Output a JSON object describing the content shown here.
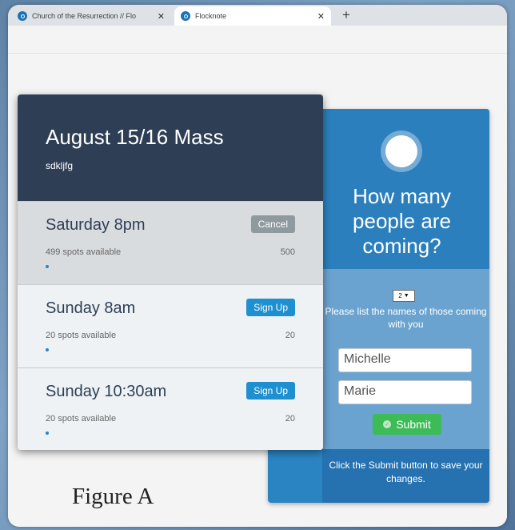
{
  "browser": {
    "tabs": [
      {
        "title": "Church of the Resurrection // Flo",
        "close": "✕"
      },
      {
        "title": "Flocknote",
        "close": "✕"
      }
    ],
    "new_tab": "+"
  },
  "event": {
    "title": "August 15/16 Mass",
    "subtitle": "sdkljfg",
    "slots": [
      {
        "name": "Saturday 8pm",
        "available": "499 spots available",
        "count": "500",
        "button": "Cancel"
      },
      {
        "name": "Sunday 8am",
        "available": "20 spots available",
        "count": "20",
        "button": "Sign Up"
      },
      {
        "name": "Sunday 10:30am",
        "available": "20 spots available",
        "count": "20",
        "button": "Sign Up"
      }
    ]
  },
  "signup_panel": {
    "question": "How many people are coming?",
    "count_select": "2",
    "instruction": "Please list the names of those coming with you",
    "names": [
      "Michelle",
      "Marie"
    ],
    "submit_label": "Submit",
    "footer": "Click the Submit button to save your changes."
  },
  "figure_label": "Figure A",
  "colors": {
    "header_dark": "#2e3f55",
    "panel_blue": "#2a84c2",
    "signup_button": "#1e8fcf",
    "submit_green": "#3dbb57",
    "cancel_gray": "#8f9a9f"
  }
}
